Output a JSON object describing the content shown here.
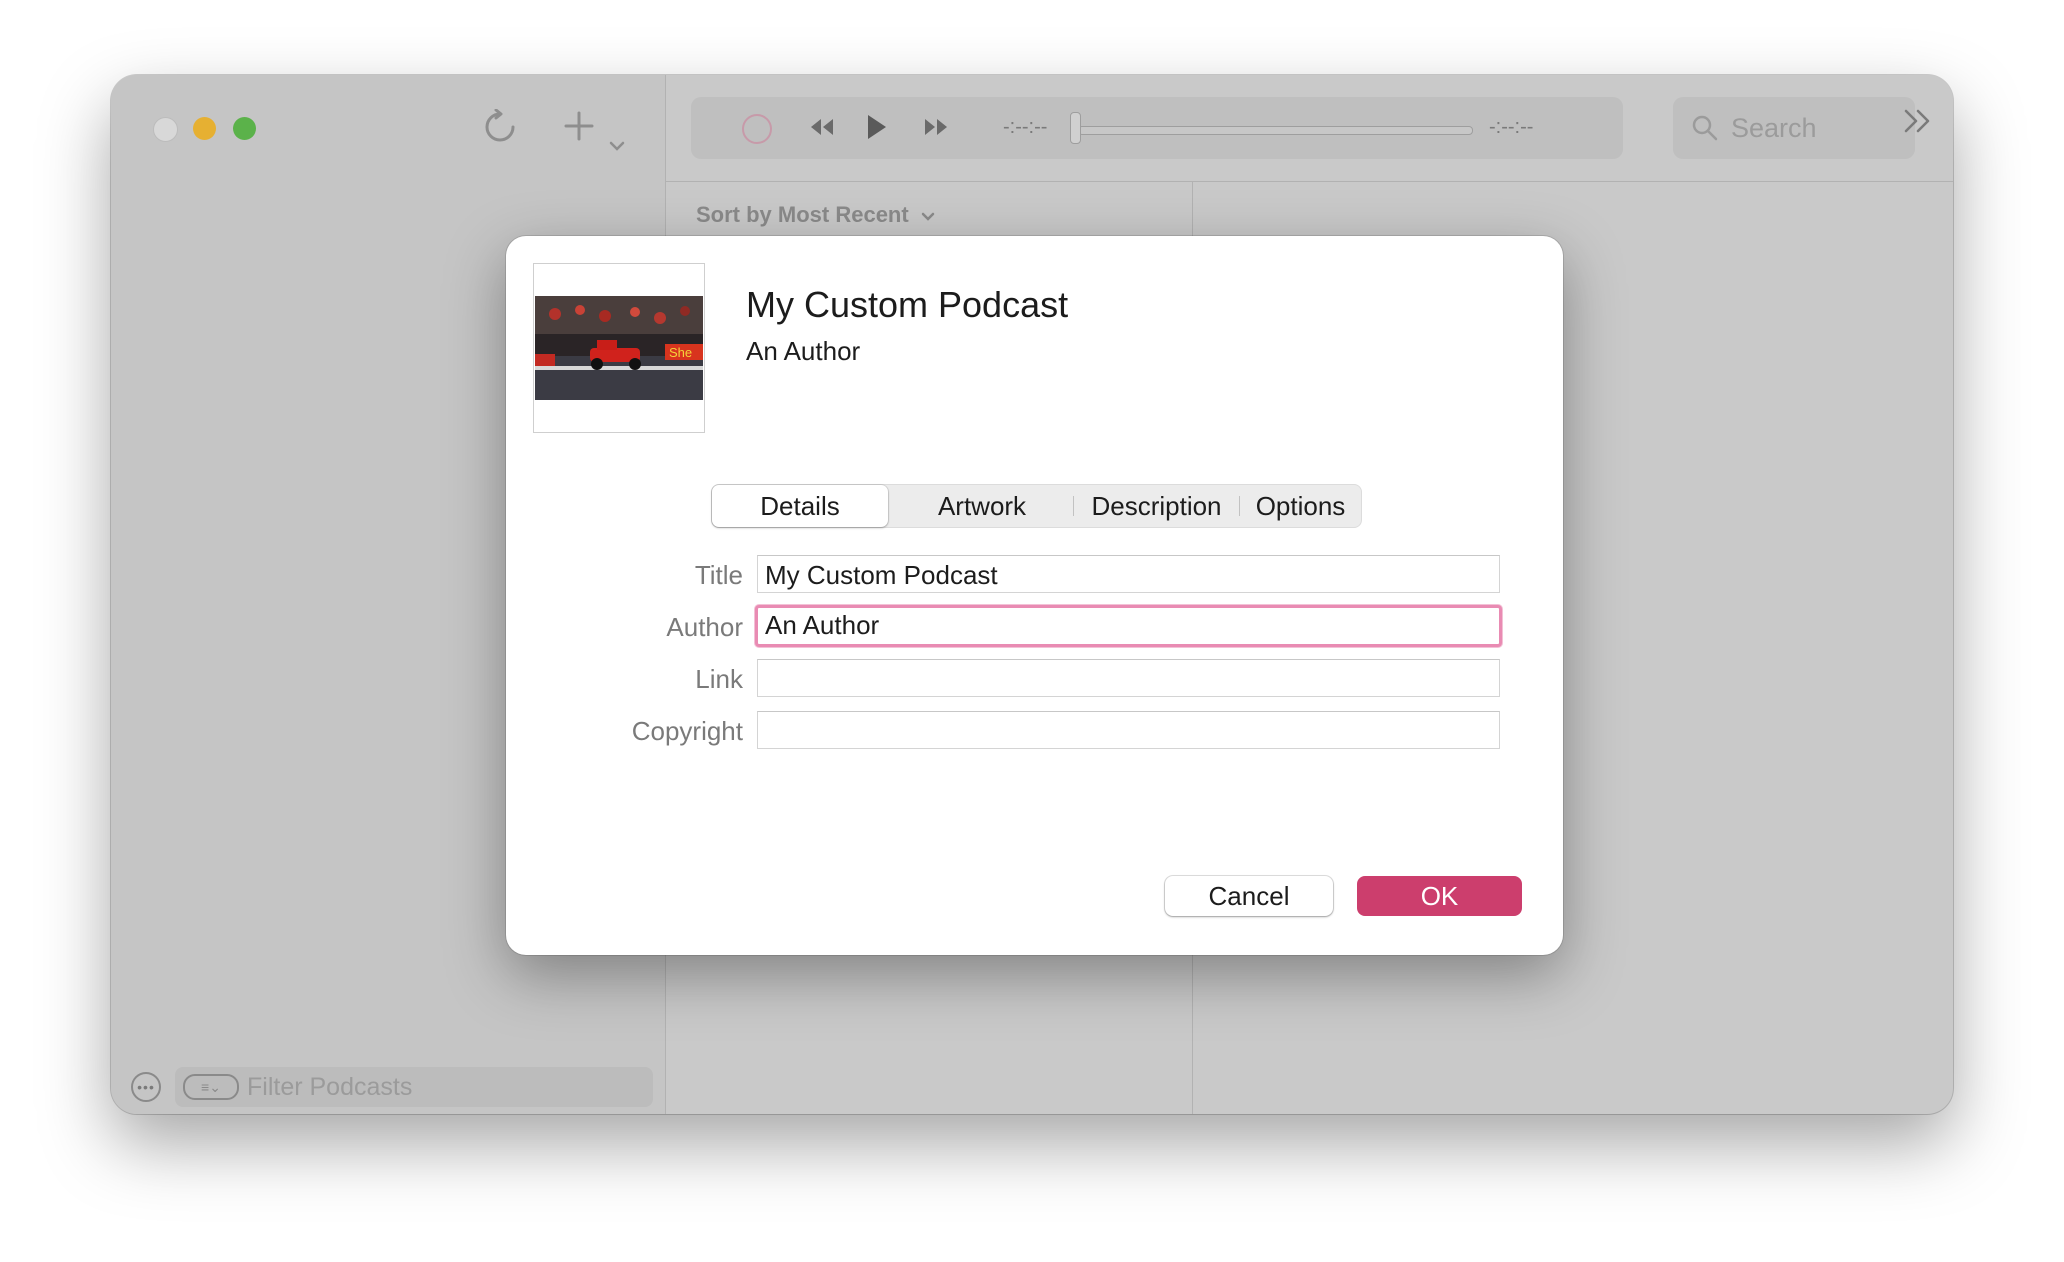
{
  "window": {
    "toolbar": {
      "time_elapsed": "-:--:--",
      "time_remaining": "-:--:--",
      "search_placeholder": "Search"
    },
    "list": {
      "sort_label": "Sort by Most Recent"
    },
    "sidebar": {
      "filter_placeholder": "Filter Podcasts"
    }
  },
  "dialog": {
    "title": "My Custom Podcast",
    "author": "An Author",
    "tabs": [
      {
        "label": "Details",
        "active": true
      },
      {
        "label": "Artwork",
        "active": false
      },
      {
        "label": "Description",
        "active": false
      },
      {
        "label": "Options",
        "active": false
      }
    ],
    "fields": {
      "title_label": "Title",
      "title_value": "My Custom Podcast",
      "author_label": "Author",
      "author_value": "An Author",
      "link_label": "Link",
      "link_value": "",
      "copyright_label": "Copyright",
      "copyright_value": ""
    },
    "buttons": {
      "cancel": "Cancel",
      "ok": "OK"
    }
  },
  "colors": {
    "accent": "#cc3e6d",
    "focus_ring": "#e98bb3"
  }
}
